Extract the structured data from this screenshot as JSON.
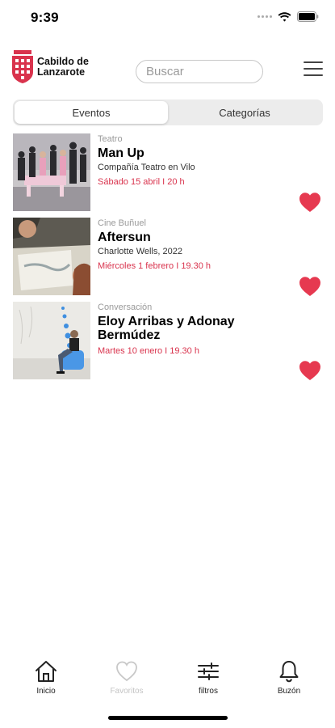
{
  "status_bar": {
    "time": "9:39"
  },
  "header": {
    "logo_line1": "Cabildo de",
    "logo_line2": "Lanzarote",
    "search_placeholder": "Buscar",
    "menu_icon": "hamburger-menu-icon"
  },
  "tabs": [
    {
      "label": "Eventos",
      "selected": true
    },
    {
      "label": "Categorías",
      "selected": false
    }
  ],
  "events": [
    {
      "category": "Teatro",
      "title": "Man Up",
      "subtitle": "Compañía Teatro en Vilo",
      "date": "Sábado 15 abril I 20 h",
      "favorite": true
    },
    {
      "category": "Cine Buñuel",
      "title": "Aftersun",
      "subtitle": "Charlotte Wells, 2022",
      "date": "Miércoles 1 febrero I 19.30 h",
      "favorite": true
    },
    {
      "category": "Conversación",
      "title": "Eloy Arribas y Adonay Bermúdez",
      "subtitle": "",
      "date": "Martes 10 enero I 19.30 h",
      "favorite": true
    }
  ],
  "bottom_nav": [
    {
      "label": "Inicio",
      "icon": "home-icon"
    },
    {
      "label": "Favoritos",
      "icon": "heart-outline-icon"
    },
    {
      "label": "filtros",
      "icon": "sliders-icon"
    },
    {
      "label": "Buzón",
      "icon": "bell-icon"
    }
  ],
  "colors": {
    "accent_red": "#d9334d",
    "heart_red": "#e63950",
    "segment_bg": "#ececec"
  }
}
